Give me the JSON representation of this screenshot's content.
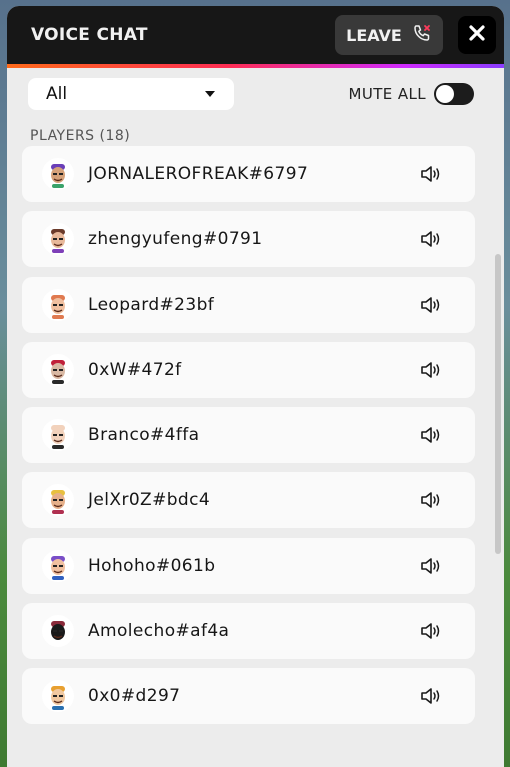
{
  "header": {
    "title": "VOICE CHAT",
    "leave_label": "LEAVE"
  },
  "filter": {
    "selected": "All",
    "mute_all_label": "MUTE ALL",
    "mute_all_on": false
  },
  "players_heading": "PLAYERS (18)",
  "players": [
    {
      "name": "JORNALEROFREAK#6797"
    },
    {
      "name": "zhengyufeng#0791"
    },
    {
      "name": "Leopard#23bf"
    },
    {
      "name": "0xW#472f"
    },
    {
      "name": "Branco#4ffa"
    },
    {
      "name": "JelXr0Z#bdc4"
    },
    {
      "name": "Hohoho#061b"
    },
    {
      "name": "Amolecho#af4a"
    },
    {
      "name": "0x0#d297"
    }
  ],
  "colors": {
    "header_bg": "#171717",
    "accent_gradient": [
      "#ff6a1a",
      "#ff2d55",
      "#d02bff",
      "#8b3dff"
    ],
    "panel_bg": "#ececec",
    "row_bg": "#fafafa"
  }
}
